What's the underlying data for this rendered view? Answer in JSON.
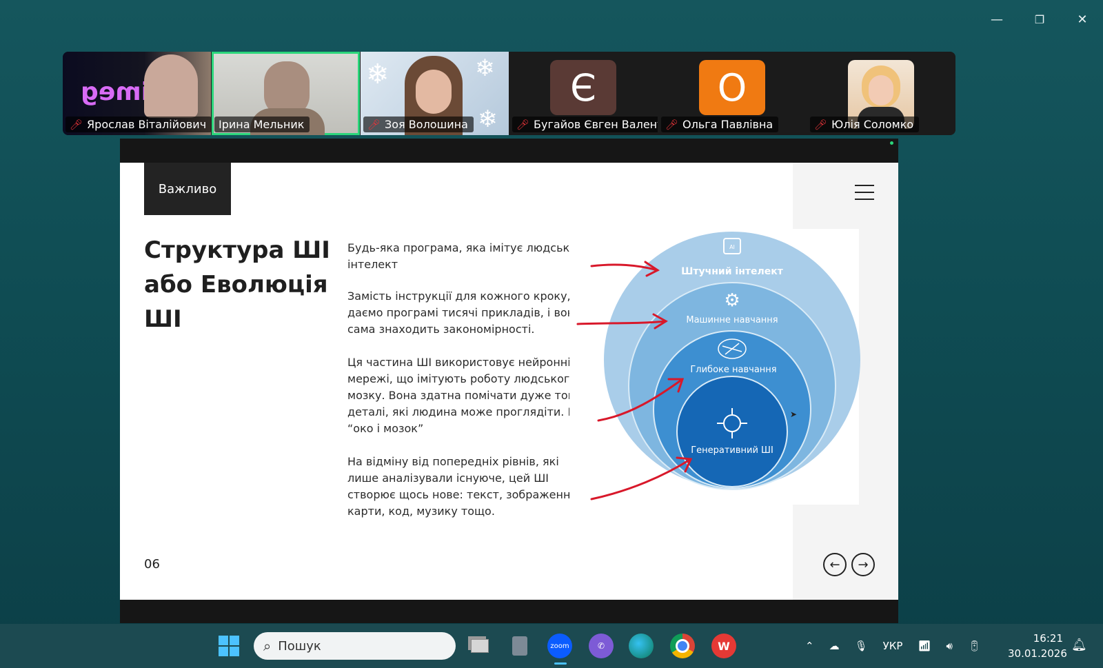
{
  "window_controls": {
    "minimize": "—",
    "restore": "❐",
    "close": "✕"
  },
  "participants": [
    {
      "name": "Ярослав Віталійович",
      "muted": true,
      "active": false
    },
    {
      "name": "Ірина Мельник",
      "muted": false,
      "active": true
    },
    {
      "name": "Зоя Волошина",
      "muted": true,
      "active": false
    },
    {
      "name": "Бугайов Євген Валент...",
      "muted": true,
      "active": false,
      "initial": "Є",
      "avatar_color": "#5a3a35"
    },
    {
      "name": "Ольга Павлівна",
      "muted": true,
      "active": false,
      "initial": "О",
      "avatar_color": "#f07a12"
    },
    {
      "name": "Юлія Соломко",
      "muted": true,
      "active": false
    }
  ],
  "tile_logo": "inimeg",
  "slide": {
    "badge": "Важливо",
    "title": "Структура ШІ або Еволюція ШІ",
    "paragraphs": [
      "Будь-яка програма, яка імітує людський інтелект",
      "Замість інструкції для кожного кроку, ми даємо програмі тисячі прикладів, і вона сама знаходить закономірності.",
      "Ця частина ШІ використовує нейронні мережі, що імітують роботу людського мозку. Вона здатна помічати дуже тонкі деталі, які людина може проглядіти. Це “око і мозок”",
      "На відміну від попередніх рівнів, які лише аналізували існуюче, цей ШІ створює щось нове: текст, зображення, карти, код, музику тощо."
    ],
    "diagram_labels": {
      "ai": "Штучний інтелект",
      "ml": "Машинне навчання",
      "dl": "Глибоке навчання",
      "gen": "Генеративний ШІ",
      "ai_chip": "AI"
    },
    "page_number": "06",
    "nav_prev": "←",
    "nav_next": "→"
  },
  "taskbar": {
    "search_placeholder": "Пошук",
    "zoom_label": "zoom",
    "language": "УКР",
    "time": "16:21",
    "date": "30.01.2026"
  },
  "colors": {
    "ai_circle": "#a9cde9",
    "ml_circle": "#7eb6e0",
    "dl_circle": "#3d8fd1",
    "gen_circle": "#1567b5",
    "arrow": "#d8182a",
    "active_outline": "#2bd67b"
  }
}
